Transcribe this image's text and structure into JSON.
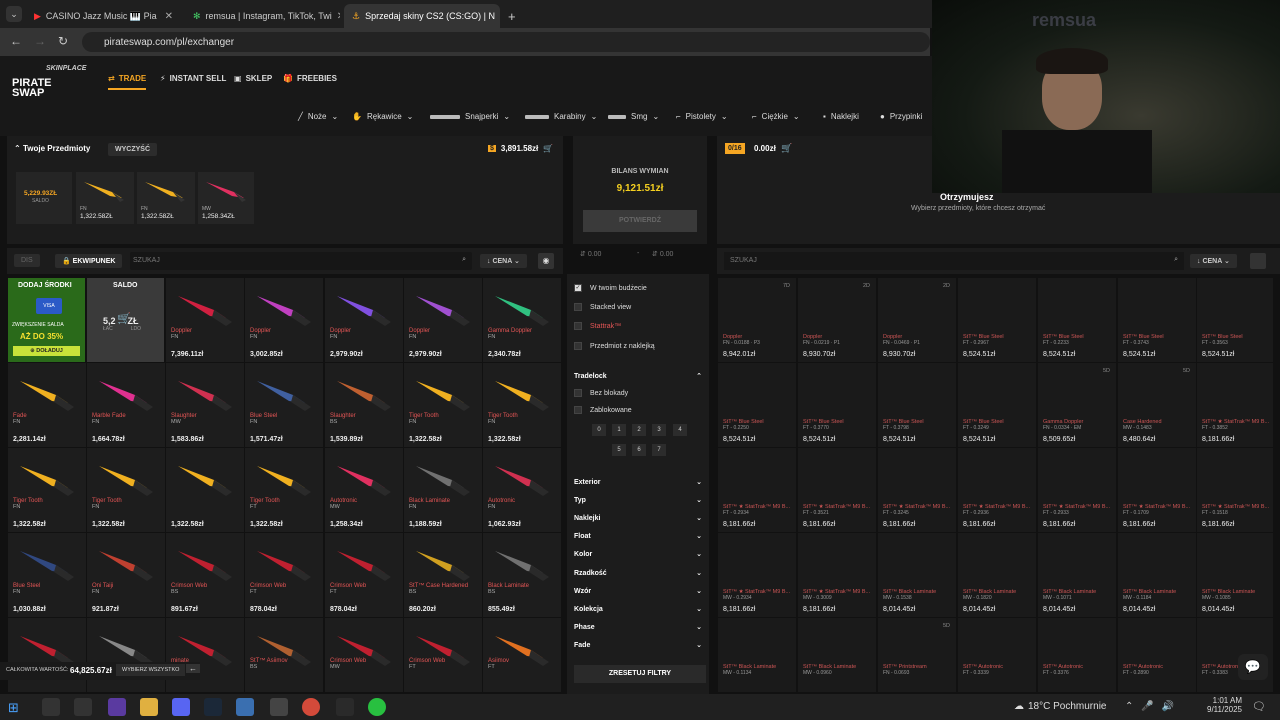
{
  "browser": {
    "tabs": [
      {
        "label": "CASINO Jazz Music 🎹 Pia"
      },
      {
        "label": "remsua | Instagram, TikTok, Twi"
      },
      {
        "label": "Sprzedaj skiny CS2 (CS:GO) | N"
      }
    ],
    "url": "pirateswap.com/pl/exchanger"
  },
  "site": {
    "brand_top": "SKINPLACE",
    "brand": "PIRATE SWAP",
    "nav": [
      "TRADE",
      "INSTANT SELL",
      "SKLEP",
      "FREEBIES"
    ],
    "categories": [
      "Noże",
      "Rękawice",
      "Snajperki",
      "Karabiny",
      "Smg",
      "Pistolety",
      "Ciężkie",
      "Naklejki",
      "Przypinki"
    ],
    "accent": "#f5a623"
  },
  "left": {
    "title": "Twoje Przedmioty",
    "clear": "WYCZYŚĆ",
    "total": "3,891.58zł",
    "saldo_value": "5,229.93ZŁ",
    "saldo_label": "SALDO",
    "selected": [
      {
        "ex": "FN",
        "price": "1,322.58ZŁ"
      },
      {
        "ex": "FN",
        "price": "1,322.58ZŁ"
      },
      {
        "ex": "MW",
        "price": "1,258.34ZŁ"
      }
    ],
    "tab_dis": "DIS",
    "tab_inv": "EKWIPUNEK",
    "search": "SZUKAJ",
    "sort": "CENA",
    "promo": {
      "title": "DODAJ ŚRODKI",
      "visa": "VISA",
      "increase": "ZWIĘKSZENIE SALDA",
      "pct": "AŻ DO 35%",
      "btn": "DOŁADUJ"
    },
    "saldo_tile": {
      "title": "SALDO",
      "value": "5,2",
      "unit": "ZŁ",
      "sub1": "ŁAC",
      "sub2": "LDO"
    },
    "items": [
      {
        "name": "Doppler",
        "ex": "FN",
        "price": "7,396.11zł"
      },
      {
        "name": "Doppler",
        "ex": "FN",
        "price": "3,002.85zł"
      },
      {
        "name": "Doppler",
        "ex": "FN",
        "price": "2,979.90zł"
      },
      {
        "name": "Doppler",
        "ex": "FN",
        "price": "2,979.90zł"
      },
      {
        "name": "Gamma Doppler",
        "ex": "FN",
        "price": "2,340.78zł"
      },
      {
        "name": "Fade",
        "ex": "FN",
        "price": "2,281.14zł"
      },
      {
        "name": "Marble Fade",
        "ex": "FN",
        "price": "1,664.78zł"
      },
      {
        "name": "Slaughter",
        "ex": "MW",
        "price": "1,583.86zł"
      },
      {
        "name": "Blue Steel",
        "ex": "FN",
        "price": "1,571.47zł"
      },
      {
        "name": "Slaughter",
        "ex": "BS",
        "price": "1,539.89zł"
      },
      {
        "name": "Tiger Tooth",
        "ex": "FN",
        "price": "1,322.58zł"
      },
      {
        "name": "Tiger Tooth",
        "ex": "FN",
        "price": "1,322.58zł"
      },
      {
        "name": "Tiger Tooth",
        "ex": "FN",
        "price": "1,322.58zł"
      },
      {
        "name": "Tiger Tooth",
        "ex": "FN",
        "price": "1,322.58zł"
      },
      {
        "name": "",
        "ex": "",
        "price": "1,322.58zł"
      },
      {
        "name": "Tiger Tooth",
        "ex": "FT",
        "price": "1,322.58zł"
      },
      {
        "name": "Autotronic",
        "ex": "MW",
        "price": "1,258.34zł"
      },
      {
        "name": "Black Laminate",
        "ex": "FN",
        "price": "1,188.59zł"
      },
      {
        "name": "Autotronic",
        "ex": "FN",
        "price": "1,062.93zł"
      },
      {
        "name": "Blue Steel",
        "ex": "FN",
        "price": "1,030.88zł"
      },
      {
        "name": "Oni Taiji",
        "ex": "FN",
        "price": "921.87zł"
      },
      {
        "name": "Crimson Web",
        "ex": "BS",
        "price": "891.67zł"
      },
      {
        "name": "Crimson Web",
        "ex": "FT",
        "price": "878.04zł"
      },
      {
        "name": "Crimson Web",
        "ex": "FT",
        "price": "878.04zł"
      },
      {
        "name": "StT™ Case Hardened",
        "ex": "BS",
        "price": "860.20zł"
      },
      {
        "name": "Black Laminate",
        "ex": "BS",
        "price": "855.49zł"
      },
      {
        "name": "",
        "ex": "BS",
        "price": ""
      },
      {
        "name": "",
        "ex": "FT",
        "price": ""
      },
      {
        "name": "minate",
        "ex": "FT",
        "price": ""
      },
      {
        "name": "StT™ Asiimov",
        "ex": "BS",
        "price": ""
      },
      {
        "name": "Crimson Web",
        "ex": "MW",
        "price": ""
      },
      {
        "name": "Crimson Web",
        "ex": "FT",
        "price": ""
      },
      {
        "name": "Asiimov",
        "ex": "FT",
        "price": ""
      }
    ],
    "total_label": "CAŁKOWITA WARTOŚĆ:",
    "total_value": "64,825.67zł",
    "withdraw_all": "WYBIERZ WSZYSTKO"
  },
  "middle": {
    "balance_label": "BILANS WYMIAN",
    "balance_value": "9,121.51zł",
    "confirm": "POTWIERDŹ",
    "min": "0.00",
    "max": "0.00",
    "checks": [
      "W twoim budżecie",
      "Stacked view",
      "Stattrak™",
      "Przedmiot z naklejką"
    ],
    "tradelock": "Tradelock",
    "tl_opts": [
      "Bez blokady",
      "Zablokowane"
    ],
    "days": [
      "0",
      "1",
      "2",
      "3",
      "4",
      "5",
      "6",
      "7"
    ],
    "sections": [
      "Exterior",
      "Typ",
      "Naklejki",
      "Float",
      "Kolor",
      "Rzadkość",
      "Wzór",
      "Kolekcja",
      "Phase",
      "Fade"
    ],
    "reset": "ZRESETUJ FILTRY"
  },
  "right": {
    "count": "0/16",
    "total": "0.00zł",
    "receive_title": "Otrzymujesz",
    "receive_sub": "Wybierz przedmioty, które chcesz otrzymać",
    "search": "SZUKAJ",
    "sort": "CENA",
    "items": [
      {
        "lock": "7D",
        "name": "Doppler",
        "ex": "FN - 0.0188 · P3",
        "price": "8,942.01zł"
      },
      {
        "lock": "2D",
        "name": "Doppler",
        "ex": "FN - 0.0219 · P1",
        "price": "8,930.70zł"
      },
      {
        "lock": "2D",
        "name": "Doppler",
        "ex": "FN - 0.0469 · P1",
        "price": "8,930.70zł"
      },
      {
        "lock": "",
        "name": "StT™ Blue Steel",
        "ex": "FT - 0.2967",
        "price": "8,524.51zł"
      },
      {
        "lock": "",
        "name": "StT™ Blue Steel",
        "ex": "FT - 0.2233",
        "price": "8,524.51zł"
      },
      {
        "lock": "",
        "name": "StT™ Blue Steel",
        "ex": "FT - 0.3743",
        "price": "8,524.51zł"
      },
      {
        "lock": "",
        "name": "StT™ Blue Steel",
        "ex": "FT - 0.3563",
        "price": "8,524.51zł"
      },
      {
        "lock": "",
        "name": "StT™ Blue Steel",
        "ex": "FT - 0.2250",
        "price": "8,524.51zł"
      },
      {
        "lock": "",
        "name": "StT™ Blue Steel",
        "ex": "FT - 0.3770",
        "price": "8,524.51zł"
      },
      {
        "lock": "",
        "name": "StT™ Blue Steel",
        "ex": "FT - 0.3798",
        "price": "8,524.51zł"
      },
      {
        "lock": "",
        "name": "StT™ Blue Steel",
        "ex": "FT - 0.3249",
        "price": "8,524.51zł"
      },
      {
        "lock": "5D",
        "name": "Gamma Doppler",
        "ex": "FN - 0.0334 · EM",
        "price": "8,509.65zł"
      },
      {
        "lock": "5D",
        "name": "Case Hardened",
        "ex": "MW - 0.1483",
        "price": "8,480.64zł"
      },
      {
        "lock": "",
        "name": "StT™ ★ StatTrak™ M9 B...",
        "ex": "FT - 0.3852",
        "price": "8,181.66zł"
      },
      {
        "lock": "",
        "name": "StT™ ★ StatTrak™ M9 B...",
        "ex": "FT - 0.2934",
        "price": "8,181.66zł"
      },
      {
        "lock": "",
        "name": "StT™ ★ StatTrak™ M9 B...",
        "ex": "FT - 0.3521",
        "price": "8,181.66zł"
      },
      {
        "lock": "",
        "name": "StT™ ★ StatTrak™ M9 B...",
        "ex": "FT - 0.3245",
        "price": "8,181.66zł"
      },
      {
        "lock": "",
        "name": "StT™ ★ StatTrak™ M9 B...",
        "ex": "FT - 0.2936",
        "price": "8,181.66zł"
      },
      {
        "lock": "",
        "name": "StT™ ★ StatTrak™ M9 B...",
        "ex": "FT - 0.2933",
        "price": "8,181.66zł"
      },
      {
        "lock": "",
        "name": "StT™ ★ StatTrak™ M9 B...",
        "ex": "FT - 0.1709",
        "price": "8,181.66zł"
      },
      {
        "lock": "",
        "name": "StT™ ★ StatTrak™ M9 B...",
        "ex": "FT - 0.1518",
        "price": "8,181.66zł"
      },
      {
        "lock": "",
        "name": "StT™ ★ StatTrak™ M9 B...",
        "ex": "MW - 0.2934",
        "price": "8,181.66zł"
      },
      {
        "lock": "",
        "name": "StT™ ★ StatTrak™ M9 B...",
        "ex": "MW - 0.3009",
        "price": "8,181.66zł"
      },
      {
        "lock": "",
        "name": "StT™ Black Laminate",
        "ex": "MW - 0.1538",
        "price": "8,014.45zł"
      },
      {
        "lock": "",
        "name": "StT™ Black Laminate",
        "ex": "MW - 0.1820",
        "price": "8,014.45zł"
      },
      {
        "lock": "",
        "name": "StT™ Black Laminate",
        "ex": "MW - 0.1071",
        "price": "8,014.45zł"
      },
      {
        "lock": "",
        "name": "StT™ Black Laminate",
        "ex": "MW - 0.1184",
        "price": "8,014.45zł"
      },
      {
        "lock": "",
        "name": "StT™ Black Laminate",
        "ex": "MW - 0.1085",
        "price": "8,014.45zł"
      },
      {
        "lock": "",
        "name": "StT™ Black Laminate",
        "ex": "MW - 0.1134",
        "price": ""
      },
      {
        "lock": "",
        "name": "StT™ Black Laminate",
        "ex": "MW - 0.0960",
        "price": ""
      },
      {
        "lock": "5D",
        "name": "StT™ Printstream",
        "ex": "FN - 0.0693",
        "price": ""
      },
      {
        "lock": "",
        "name": "StT™ Autotronic",
        "ex": "FT - 0.3339",
        "price": ""
      },
      {
        "lock": "",
        "name": "StT™ Autotronic",
        "ex": "FT - 0.3376",
        "price": ""
      },
      {
        "lock": "",
        "name": "StT™ Autotronic",
        "ex": "FT - 0.2890",
        "price": ""
      },
      {
        "lock": "",
        "name": "StT™ Autotronic",
        "ex": "FT - 0.3383",
        "price": ""
      }
    ]
  },
  "stream": {
    "watermark": "remsua"
  },
  "taskbar": {
    "weather": "18°C Pochmurnie",
    "time": "1:01 AM",
    "date": "9/11/2025"
  }
}
